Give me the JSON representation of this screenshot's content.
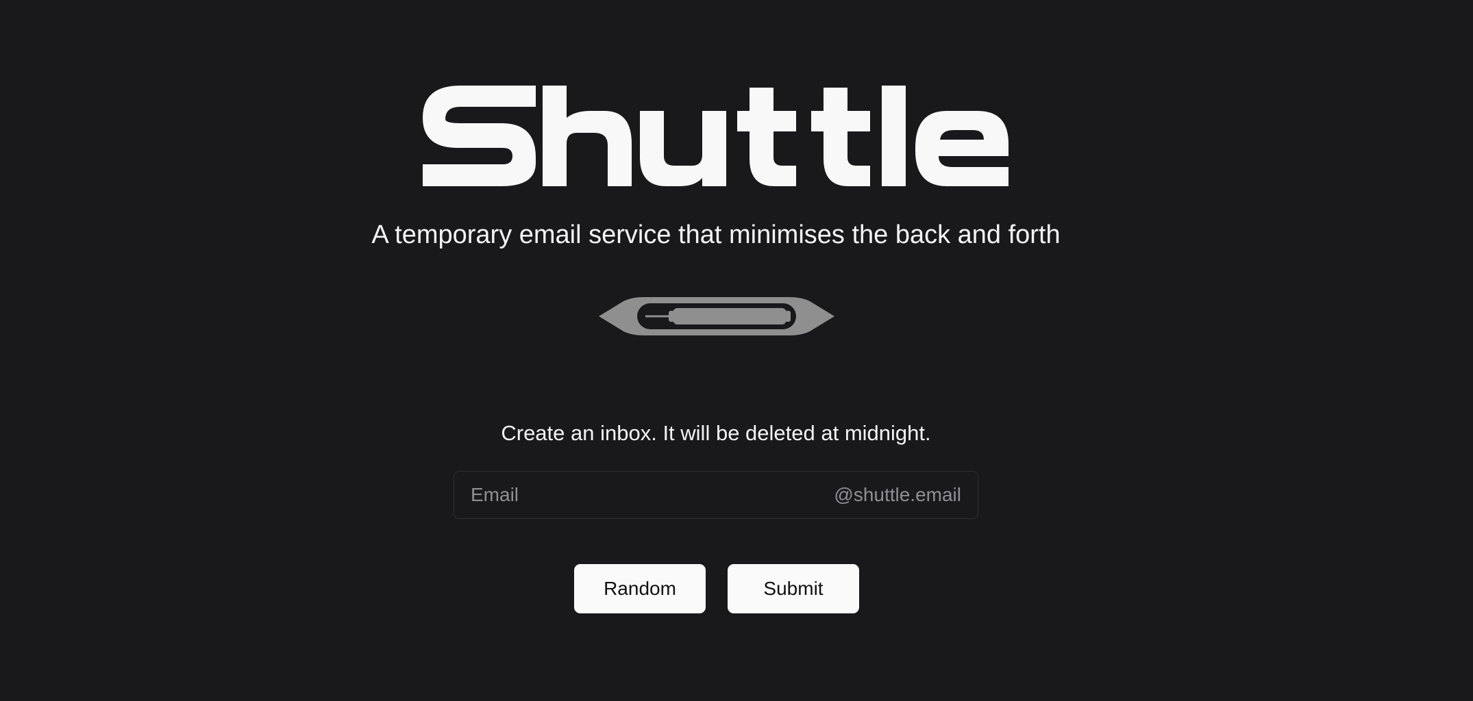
{
  "brand": {
    "name": "Shuttle",
    "tagline": "A temporary email service that minimises the back and forth"
  },
  "graphic": {
    "icon": "shuttle-icon",
    "color": "#8f8f8f"
  },
  "form": {
    "prompt": "Create an inbox. It will be deleted at midnight.",
    "email_placeholder": "Email",
    "email_value": "",
    "email_domain": "@shuttle.email",
    "random_label": "Random",
    "submit_label": "Submit"
  },
  "colors": {
    "background": "#19191b",
    "text": "#fafafa",
    "muted": "#8f8f96",
    "button_bg": "#fafafa",
    "button_text": "#111113"
  }
}
